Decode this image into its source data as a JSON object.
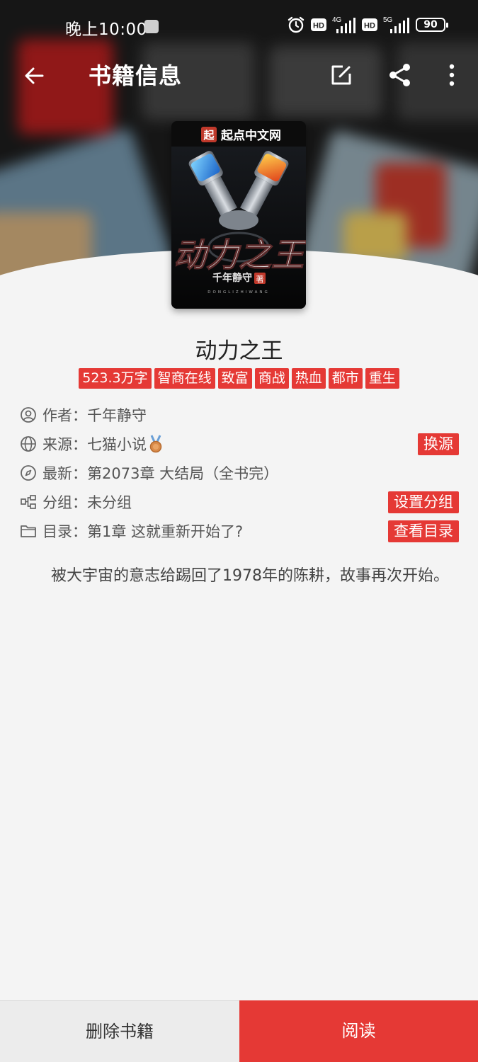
{
  "status_bar": {
    "time": "晚上10:00",
    "network_1": "4G",
    "network_2": "5G",
    "hd_badge": "HD",
    "battery": "90"
  },
  "top_bar": {
    "title": "书籍信息",
    "icons": [
      "back-arrow-icon",
      "edit-icon",
      "share-icon",
      "more-vertical-icon"
    ]
  },
  "cover": {
    "publisher_badge": "起",
    "publisher": "起点中文网",
    "title_art": "动力之王",
    "author_art": "千年静守",
    "author_suffix": "著",
    "pinyin": "DONGLIZHIWANG"
  },
  "book": {
    "name": "动力之王",
    "tags": [
      "523.3万字",
      "智商在线",
      "致富",
      "商战",
      "热血",
      "都市",
      "重生"
    ]
  },
  "info": {
    "author_label": "作者：",
    "author": "千年静守",
    "source_label": "来源：",
    "source": "七猫小说",
    "source_action": "换源",
    "latest_label": "最新：",
    "latest": "第2073章 大结局（全书完）",
    "group_label": "分组：",
    "group": "未分组",
    "group_action": "设置分组",
    "toc_label": "目录：",
    "toc": "第1章 这就重新开始了?",
    "toc_action": "查看目录"
  },
  "intro": "被大宇宙的意志给踢回了1978年的陈耕，故事再次开始。",
  "bottom_bar": {
    "delete": "删除书籍",
    "read": "阅读"
  },
  "colors": {
    "accent": "#e53935",
    "background": "#f4f4f4"
  }
}
